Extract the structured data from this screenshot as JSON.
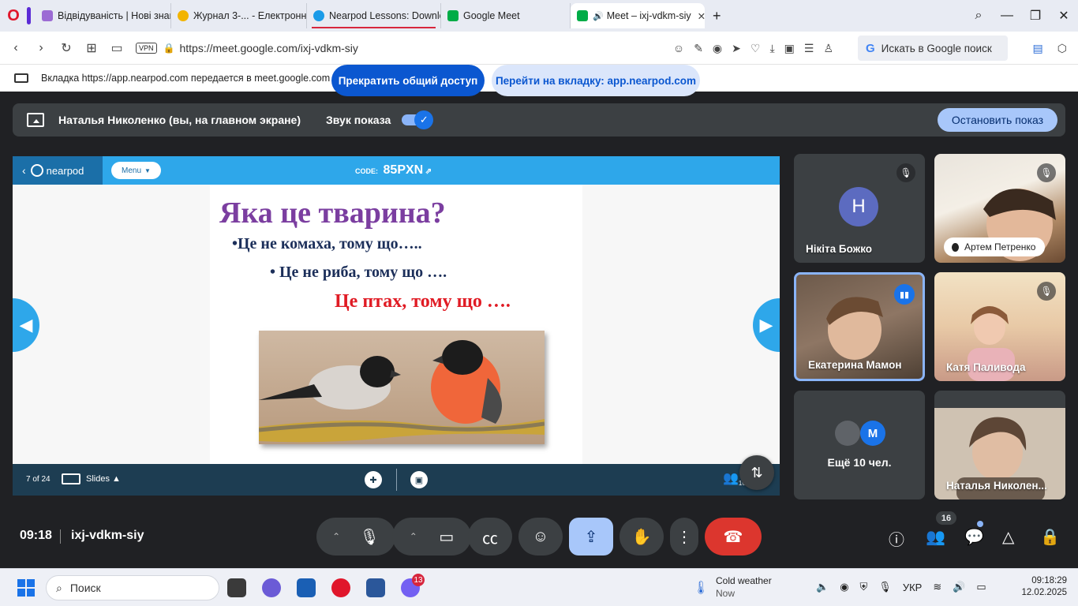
{
  "browser": {
    "tabs": [
      {
        "title": "Відвідуваність | Нові знан",
        "fav_color": "#9c6bd4"
      },
      {
        "title": "Журнал 3-... - Електронн",
        "fav_color": "#f2b400"
      },
      {
        "title": "Nearpod Lessons: Downlo",
        "fav_color": "#1a9be8"
      },
      {
        "title": "Google Meet",
        "fav_color": "#00ac47"
      },
      {
        "title": "Meet – ixj-vdkm-siy",
        "fav_color": "#00ac47"
      }
    ],
    "new_tab": "+",
    "vpn_label": "VPN",
    "url": "https://meet.google.com/ixj-vdkm-siy",
    "search_placeholder": "Искать в Google поиск"
  },
  "share_bar": {
    "text": "Вкладка https://app.nearpod.com передается в meet.google.com",
    "stop_label": "Прекратить общий доступ",
    "goto_label": "Перейти на вкладку: app.nearpod.com"
  },
  "presenting": {
    "presenter": "Наталья Николенко (вы, на главном экране)",
    "sound_label": "Звук показа",
    "sound_on": true,
    "stop_label": "Остановить показ"
  },
  "nearpod": {
    "logo": "nearpod",
    "menu": "Menu",
    "code_label": "CODE:",
    "code": "85PXN",
    "slide": {
      "title": "Яка це тварина?",
      "line1": "•Це не комаха, тому що…..",
      "line2": "• Це не риба, тому що ….",
      "line3": "Це птах, тому що …."
    },
    "page": "7 of 24",
    "slides_label": "Slides",
    "participants": "10"
  },
  "participants": [
    {
      "name": "Нікіта Божко",
      "initial": "Н",
      "avatar_color": "#5c6bc0",
      "muted": true
    },
    {
      "name": "Артем Петренко",
      "muted": true
    },
    {
      "name": "Екатерина Мамон",
      "speaking": true
    },
    {
      "name": "Катя Паливода",
      "muted": true
    },
    {
      "name": "Ещё 10 чел.",
      "initial": "M"
    },
    {
      "name": "Наталья Николен..."
    }
  ],
  "controls": {
    "time": "09:18",
    "meeting_code": "ixj-vdkm-siy",
    "people_count": "16"
  },
  "taskbar": {
    "search": "Поиск",
    "badge": "13",
    "weather_title": "Cold weather",
    "weather_sub": "Now",
    "lang": "УКР",
    "time": "09:18:29",
    "date": "12.02.2025"
  },
  "colors": {
    "meet_bg": "#202124",
    "accent": "#1a73e8",
    "nearpod_blue": "#2ea7ea",
    "end_call": "#dc362e"
  }
}
